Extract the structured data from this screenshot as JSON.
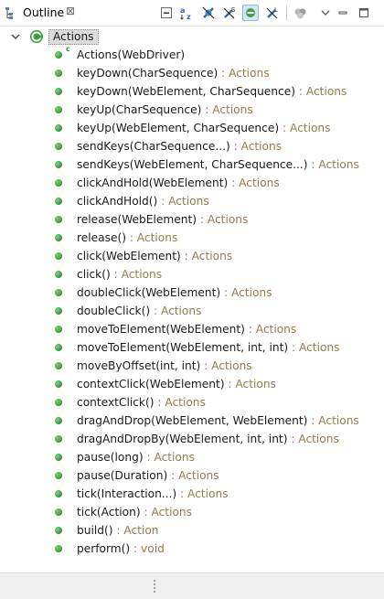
{
  "view": {
    "title": "Outline",
    "close_glyph": "⊠",
    "icon": "outline-view-icon"
  },
  "toolbar": {
    "icons": [
      "collapse-all-icon",
      "sort-alphabetically-icon",
      "hide-fields-icon",
      "hide-static-members-icon",
      "hide-non-public-members-icon",
      "hide-local-types-icon",
      "focus-on-active-task-icon",
      "view-menu-chevron-icon",
      "minimize-icon",
      "maximize-icon"
    ]
  },
  "tree": {
    "root": {
      "label": "Actions",
      "icon": "class-icon",
      "expanded": true
    },
    "items": [
      {
        "name": "Actions(WebDriver)",
        "ret": "",
        "ctor": true
      },
      {
        "name": "keyDown(CharSequence)",
        "ret": " : Actions"
      },
      {
        "name": "keyDown(WebElement, CharSequence)",
        "ret": " : Actions"
      },
      {
        "name": "keyUp(CharSequence)",
        "ret": " : Actions"
      },
      {
        "name": "keyUp(WebElement, CharSequence)",
        "ret": " : Actions"
      },
      {
        "name": "sendKeys(CharSequence...)",
        "ret": " : Actions"
      },
      {
        "name": "sendKeys(WebElement, CharSequence...)",
        "ret": " : Actions"
      },
      {
        "name": "clickAndHold(WebElement)",
        "ret": " : Actions"
      },
      {
        "name": "clickAndHold()",
        "ret": " : Actions"
      },
      {
        "name": "release(WebElement)",
        "ret": " : Actions"
      },
      {
        "name": "release()",
        "ret": " : Actions"
      },
      {
        "name": "click(WebElement)",
        "ret": " : Actions"
      },
      {
        "name": "click()",
        "ret": " : Actions"
      },
      {
        "name": "doubleClick(WebElement)",
        "ret": " : Actions"
      },
      {
        "name": "doubleClick()",
        "ret": " : Actions"
      },
      {
        "name": "moveToElement(WebElement)",
        "ret": " : Actions"
      },
      {
        "name": "moveToElement(WebElement, int, int)",
        "ret": " : Actions"
      },
      {
        "name": "moveByOffset(int, int)",
        "ret": " : Actions"
      },
      {
        "name": "contextClick(WebElement)",
        "ret": " : Actions"
      },
      {
        "name": "contextClick()",
        "ret": " : Actions"
      },
      {
        "name": "dragAndDrop(WebElement, WebElement)",
        "ret": " : Actions"
      },
      {
        "name": "dragAndDropBy(WebElement, int, int)",
        "ret": " : Actions"
      },
      {
        "name": "pause(long)",
        "ret": " : Actions"
      },
      {
        "name": "pause(Duration)",
        "ret": " : Actions"
      },
      {
        "name": "tick(Interaction...)",
        "ret": " : Actions"
      },
      {
        "name": "tick(Action)",
        "ret": " : Actions"
      },
      {
        "name": "build()",
        "ret": " : Action"
      },
      {
        "name": "perform()",
        "ret": " : void"
      }
    ]
  },
  "colors": {
    "return_type": "#957d47",
    "method_public": "#3fa33f",
    "selection_bg": "#dcdcdc",
    "toolbar_active": "#cfe6f7"
  }
}
